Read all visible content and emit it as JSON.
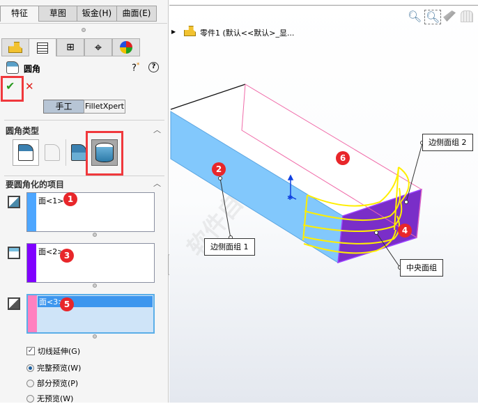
{
  "tabs": [
    {
      "label": "特征"
    },
    {
      "label": "草图"
    },
    {
      "label": "钣金(H)"
    },
    {
      "label": "曲面(E)"
    }
  ],
  "icon_tabs": [
    "feature-manager-icon",
    "property-manager-icon",
    "configuration-manager-icon",
    "dimxpert-icon",
    "display-manager-icon"
  ],
  "feature": {
    "title": "圆角",
    "help_icons": [
      "whats-new-help-icon",
      "help-icon"
    ]
  },
  "actions": {
    "ok": "✔",
    "cancel": "✕"
  },
  "mode": {
    "manual": "手工",
    "filletxpert": "FilletXpert"
  },
  "fillet_type": {
    "heading": "圆角类型",
    "options": [
      "constant-size-fillet",
      "variable-size-fillet",
      "face-fillet",
      "full-round-fillet"
    ],
    "selected": "full-round-fillet"
  },
  "items": {
    "heading": "要圆角化的项目",
    "lists": [
      {
        "value": "面<1>",
        "badge": "1",
        "color": "#4da6ff"
      },
      {
        "value": "面<2>",
        "badge": "3",
        "color": "#8000ff"
      },
      {
        "value": "面<3>",
        "badge": "5",
        "color": "#ff80c0"
      }
    ]
  },
  "options": {
    "tangent": "切线延伸(G)",
    "tangent_checked": true,
    "preview": [
      {
        "label": "完整预览(W)",
        "checked": true
      },
      {
        "label": "部分预览(P)",
        "checked": false
      },
      {
        "label": "无预览(W)",
        "checked": false
      }
    ]
  },
  "tree": {
    "part": "零件1",
    "config": "(默认<<默认>_显..."
  },
  "view_tools": [
    "zoom-to-fit-icon",
    "zoom-to-area-icon",
    "previous-view-icon",
    "section-view-icon"
  ],
  "callouts": {
    "side1": "边侧面组 1",
    "side2": "边侧面组 2",
    "center": "中央面组"
  },
  "badges": {
    "b2": "2",
    "b4": "4",
    "b6": "6"
  },
  "watermark": "软件自学网 WWW.RJZXW.COM"
}
